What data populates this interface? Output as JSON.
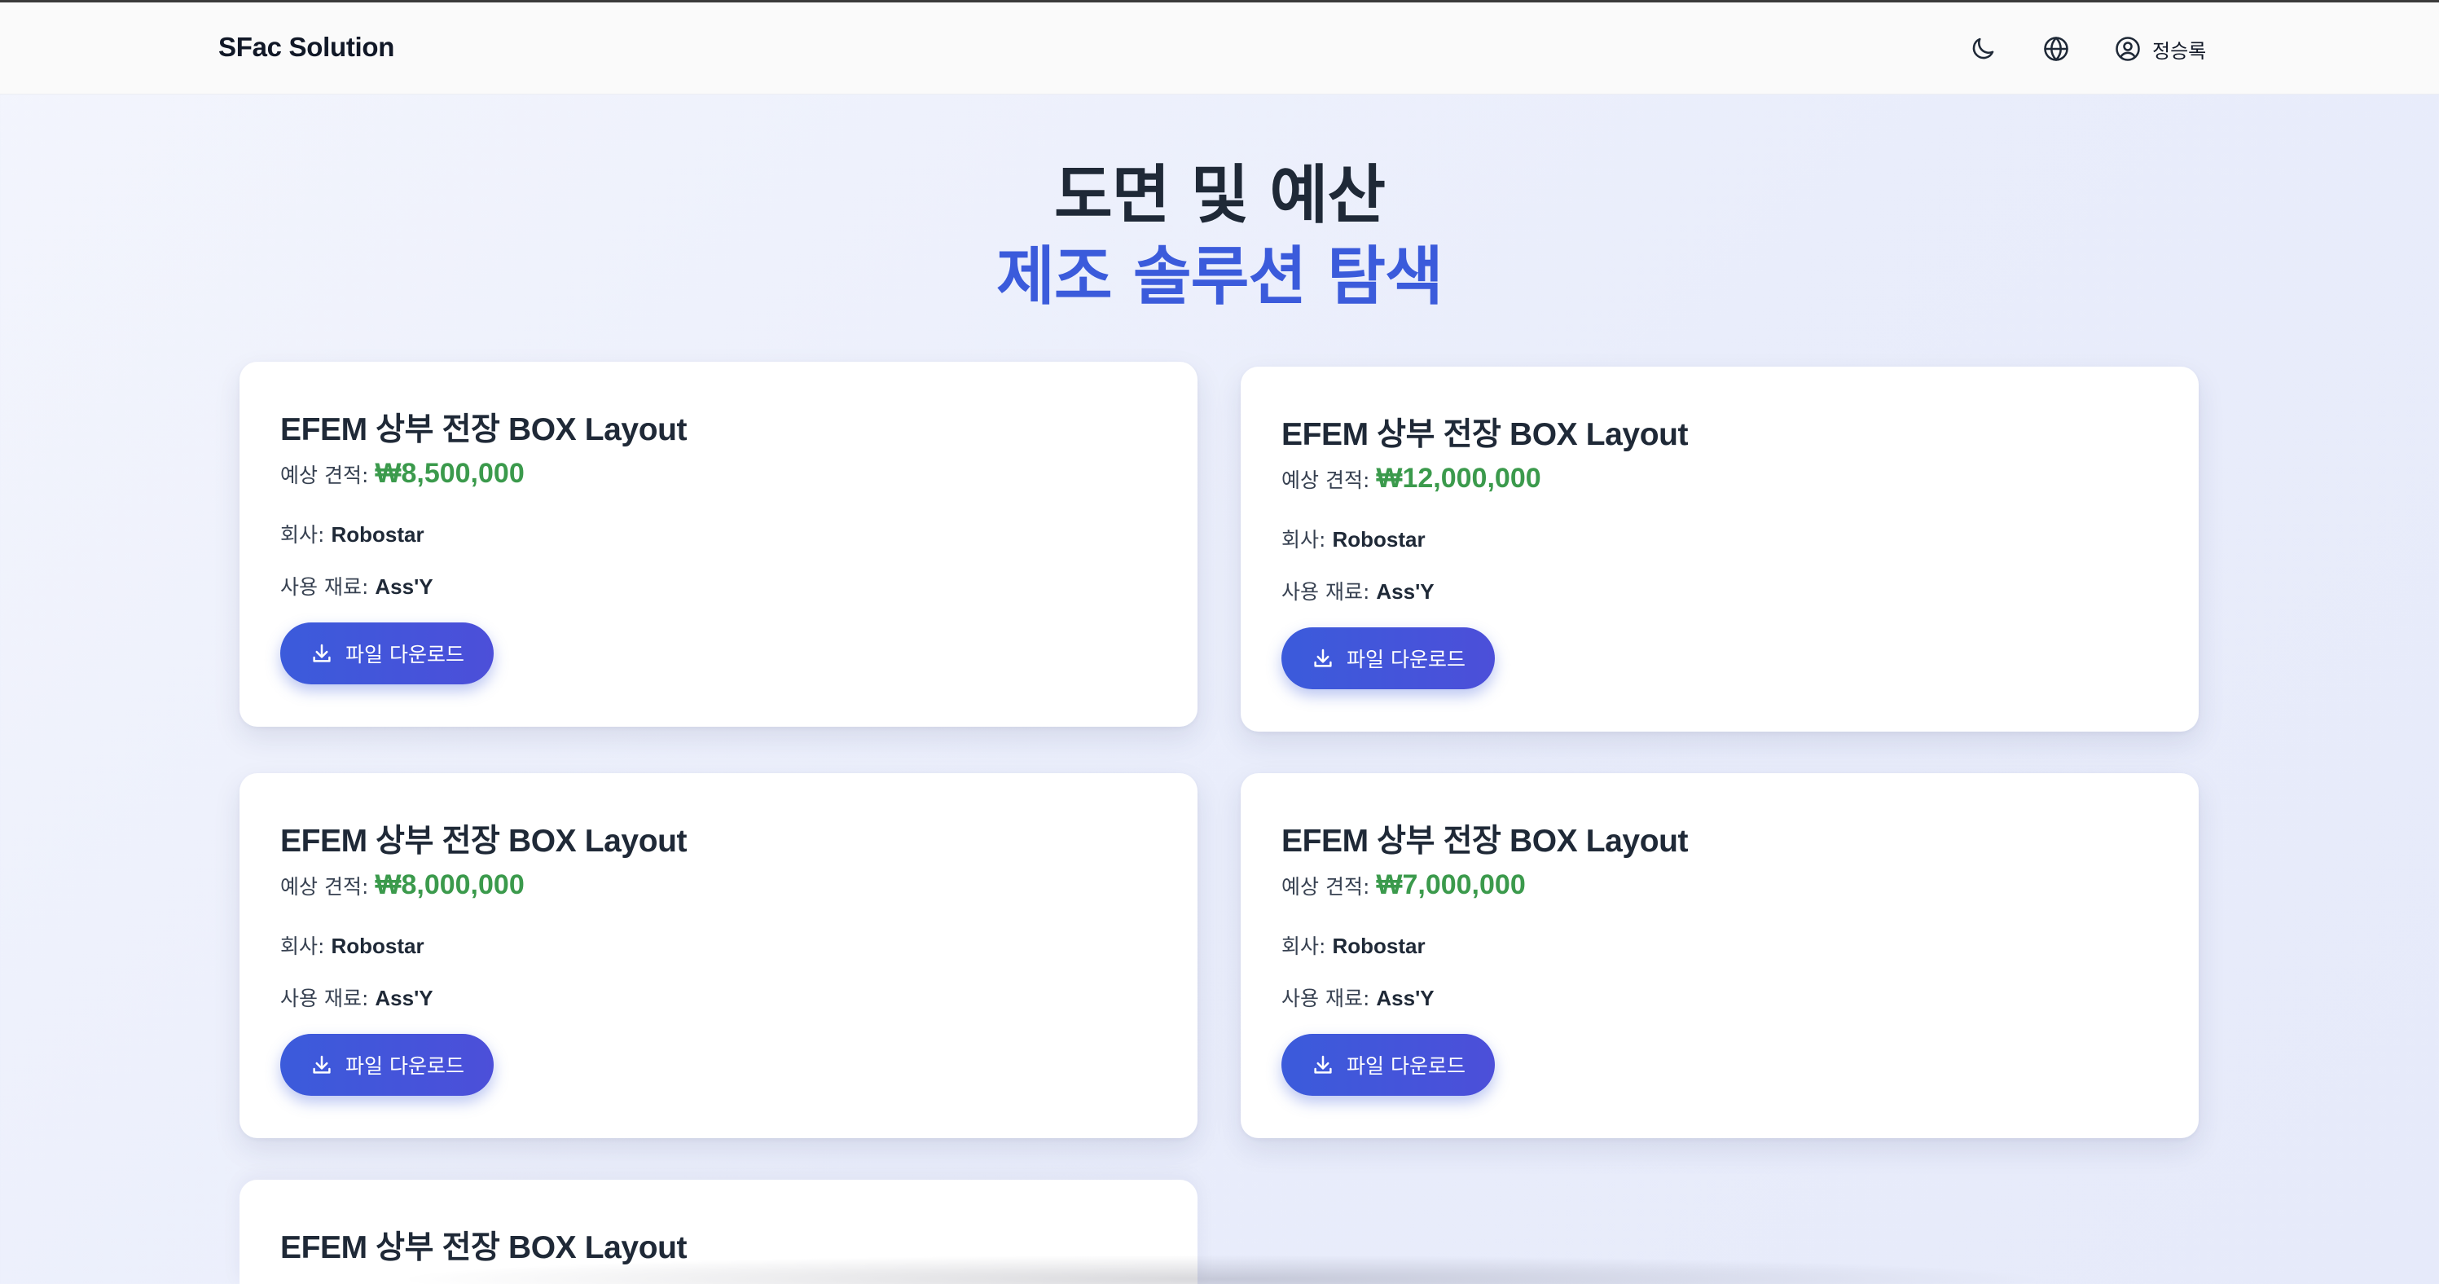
{
  "header": {
    "brand": "SFac Solution",
    "theme_icon": "moon-icon",
    "language_icon": "globe-icon",
    "user_icon": "user-circle-icon",
    "user_name": "정승록"
  },
  "hero": {
    "line1": "도면 및 예산",
    "line2": "제조 솔루션 탐색"
  },
  "cards": [
    {
      "title": "EFEM 상부 전장 BOX Layout",
      "price_label": "예상 견적:",
      "price": "₩8,500,000",
      "company_label": "회사:",
      "company": "Robostar",
      "material_label": "사용 재료:",
      "material": "Ass'Y",
      "download_label": "파일 다운로드"
    },
    {
      "title": "EFEM 상부 전장 BOX Layout",
      "price_label": "예상 견적:",
      "price": "₩12,000,000",
      "company_label": "회사:",
      "company": "Robostar",
      "material_label": "사용 재료:",
      "material": "Ass'Y",
      "download_label": "파일 다운로드"
    },
    {
      "title": "EFEM 상부 전장 BOX Layout",
      "price_label": "예상 견적:",
      "price": "₩8,000,000",
      "company_label": "회사:",
      "company": "Robostar",
      "material_label": "사용 재료:",
      "material": "Ass'Y",
      "download_label": "파일 다운로드"
    },
    {
      "title": "EFEM 상부 전장 BOX Layout",
      "price_label": "예상 견적:",
      "price": "₩7,000,000",
      "company_label": "회사:",
      "company": "Robostar",
      "material_label": "사용 재료:",
      "material": "Ass'Y",
      "download_label": "파일 다운로드"
    },
    {
      "title": "EFEM 상부 전장 BOX Layout"
    }
  ],
  "colors": {
    "accent": "#3b5bdb",
    "price": "#3b9a4c",
    "button_gradient_end": "#4c4fd9"
  }
}
